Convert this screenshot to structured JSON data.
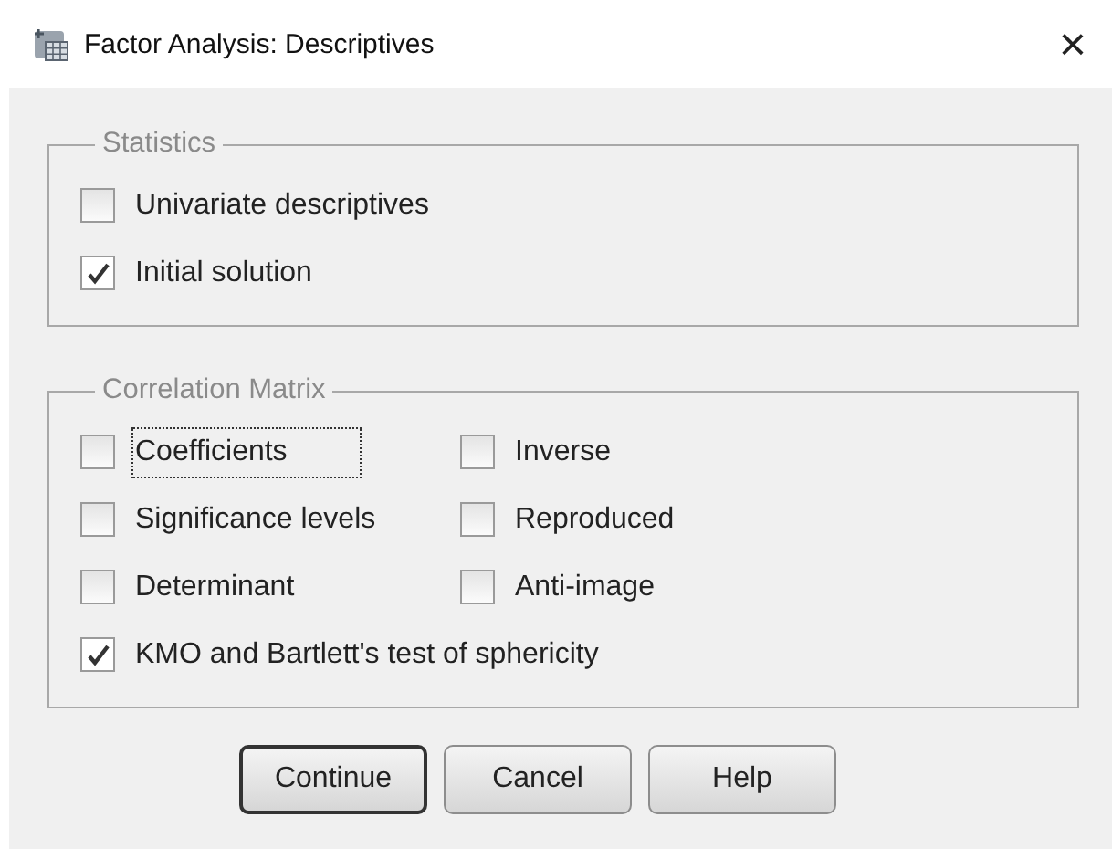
{
  "window": {
    "title": "Factor Analysis: Descriptives",
    "close": "×"
  },
  "groups": [
    {
      "title": "Statistics",
      "rows": [
        [
          {
            "label": "Univariate descriptives",
            "checked": false,
            "focused": false
          }
        ],
        [
          {
            "label": "Initial solution",
            "checked": true,
            "focused": false
          }
        ]
      ]
    },
    {
      "title": "Correlation Matrix",
      "rows": [
        [
          {
            "label": "Coefficients",
            "checked": false,
            "focused": true
          },
          {
            "label": "Inverse",
            "checked": false,
            "focused": false
          }
        ],
        [
          {
            "label": "Significance levels",
            "checked": false,
            "focused": false
          },
          {
            "label": "Reproduced",
            "checked": false,
            "focused": false
          }
        ],
        [
          {
            "label": "Determinant",
            "checked": false,
            "focused": false
          },
          {
            "label": "Anti-image",
            "checked": false,
            "focused": false
          }
        ],
        [
          {
            "label": "KMO and Bartlett's test of sphericity",
            "checked": true,
            "focused": false
          }
        ]
      ]
    }
  ],
  "buttons": [
    {
      "label": "Continue",
      "default": true
    },
    {
      "label": "Cancel",
      "default": false
    },
    {
      "label": "Help",
      "default": false
    }
  ]
}
